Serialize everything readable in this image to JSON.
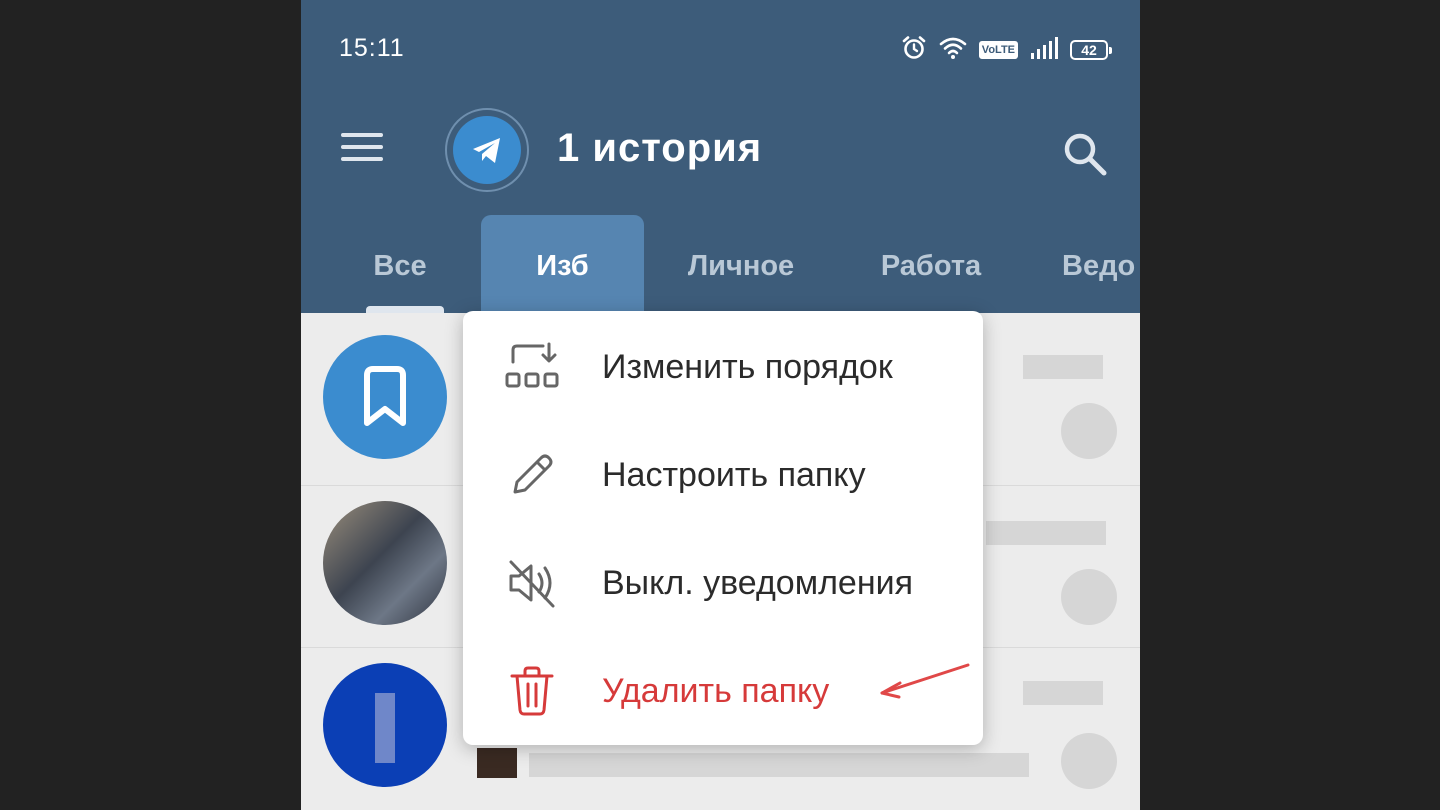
{
  "status_bar": {
    "time": "15:11",
    "volte": "VoLTE",
    "battery": "42",
    "icons": [
      "alarm-icon",
      "wifi-icon",
      "signal-icon",
      "battery-icon"
    ]
  },
  "header": {
    "title": "1 история",
    "menu_icon": "hamburger-menu-icon",
    "logo_icon": "telegram-logo-icon",
    "search_icon": "search-icon"
  },
  "tabs": [
    {
      "label": "Все",
      "active": false
    },
    {
      "label": "Изб",
      "active": true
    },
    {
      "label": "Личное",
      "active": false
    },
    {
      "label": "Работа",
      "active": false
    },
    {
      "label": "Ведо",
      "active": false
    }
  ],
  "context_menu": {
    "items": [
      {
        "label": "Изменить порядок",
        "icon": "reorder-icon"
      },
      {
        "label": "Настроить папку",
        "icon": "pencil-icon"
      },
      {
        "label": "Выкл. уведомления",
        "icon": "mute-icon"
      },
      {
        "label": "Удалить папку",
        "icon": "trash-icon",
        "color": "#d63a3a"
      }
    ]
  },
  "colors": {
    "header": "#3d5c7a",
    "active_tab": "#5685b1",
    "danger": "#d63a3a",
    "annotation_arrow": "#e04848"
  }
}
